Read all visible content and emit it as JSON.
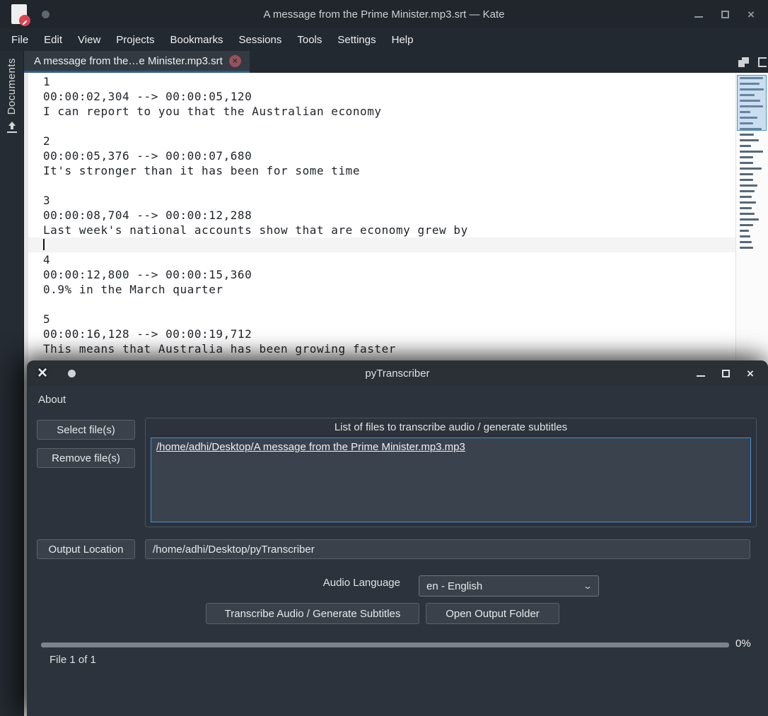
{
  "kate": {
    "titlebar": {
      "title": "A message from the Prime Minister.mp3.srt — Kate"
    },
    "menu": {
      "items": [
        "File",
        "Edit",
        "View",
        "Projects",
        "Bookmarks",
        "Sessions",
        "Tools",
        "Settings",
        "Help"
      ]
    },
    "tab": {
      "label": "A message from the…e Minister.mp3.srt"
    },
    "dock": {
      "label": "Documents"
    },
    "editor": {
      "cursor_line_index": 11,
      "lines": [
        "1",
        "00:00:02,304 --> 00:00:05,120",
        "I can report to you that the Australian economy",
        "",
        "2",
        "00:00:05,376 --> 00:00:07,680",
        "It's stronger than it has been for some time",
        "",
        "3",
        "00:00:08,704 --> 00:00:12,288",
        "Last week's national accounts show that are economy grew by",
        "",
        "4",
        "00:00:12,800 --> 00:00:15,360",
        "0.9% in the March quarter",
        "",
        "5",
        "00:00:16,128 --> 00:00:19,712",
        "This means that Australia has been growing faster"
      ]
    }
  },
  "pytranscriber": {
    "titlebar": {
      "title": "pyTranscriber"
    },
    "menu": {
      "about": "About"
    },
    "buttons": {
      "select": "Select file(s)",
      "remove": "Remove file(s)",
      "output_location": "Output Location",
      "transcribe": "Transcribe Audio / Generate Subtitles",
      "open_output": "Open Output Folder"
    },
    "filelist": {
      "title": "List of files to transcribe audio / generate subtitles",
      "items": [
        "/home/adhi/Desktop/A message from the Prime Minister.mp3.mp3"
      ]
    },
    "output_location_value": "/home/adhi/Desktop/pyTranscriber",
    "audio_language": {
      "label": "Audio Language",
      "selected": "en - English"
    },
    "progress": {
      "value": 0,
      "percent_label": "0%",
      "file_label": "File 1 of 1"
    }
  },
  "colors": {
    "accent_blue": "#3daee9",
    "tab_underline": "#2c5c8e",
    "kate_titlebar": "#20262b",
    "kate_menubar": "#232930",
    "dock_bg": "#262c33",
    "editor_bg": "#ffffff",
    "pyt_bg": "#2d333c",
    "close_badge": "#97525b"
  }
}
